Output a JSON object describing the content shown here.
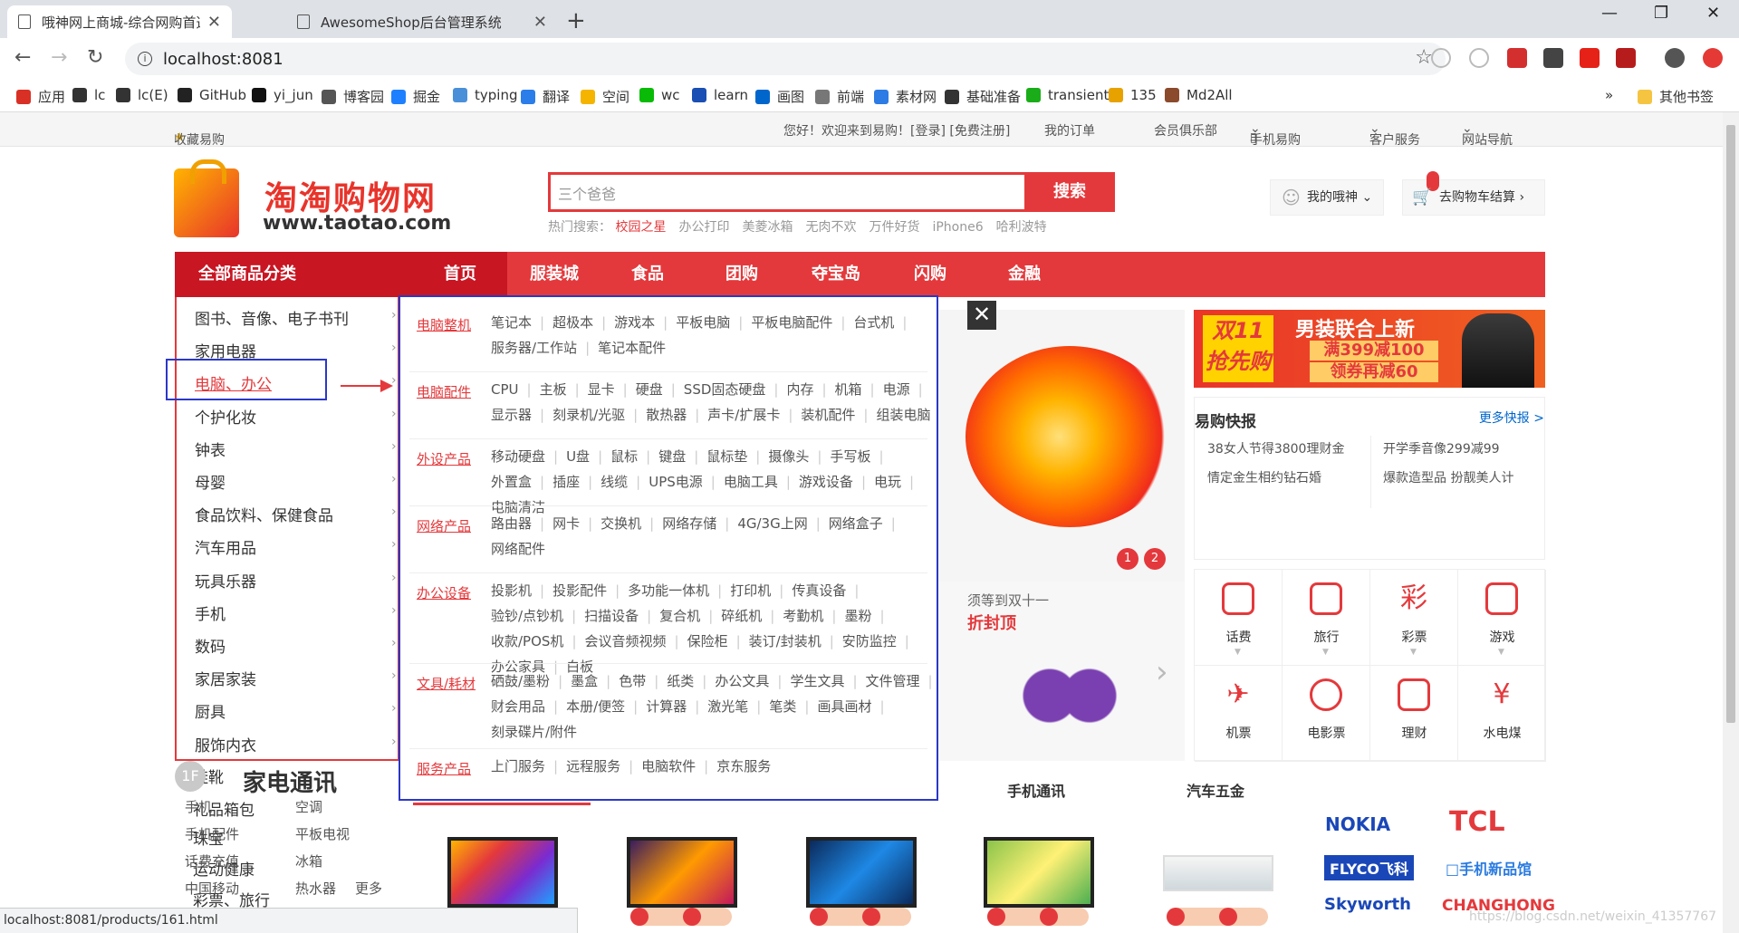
{
  "browser": {
    "tabs": [
      {
        "label": "哦神网上商城-综合网购首选（JD"
      },
      {
        "label": "AwesomeShop后台管理系统"
      }
    ],
    "new_tab": "+",
    "url": "localhost:8081",
    "window_controls": {
      "min": "—",
      "max": "❐",
      "close": "✕"
    }
  },
  "bookmarks": [
    {
      "label": "应用",
      "color": "#d93025"
    },
    {
      "label": "lc",
      "color": "#333333"
    },
    {
      "label": "lc(E)",
      "color": "#333333"
    },
    {
      "label": "GitHub",
      "color": "#222222"
    },
    {
      "label": "yi_jun",
      "color": "#111111"
    },
    {
      "label": "博客园",
      "color": "#555555"
    },
    {
      "label": "掘金",
      "color": "#1e80ff"
    },
    {
      "label": "typing",
      "color": "#4a90d9"
    },
    {
      "label": "翻译",
      "color": "#2b7de9"
    },
    {
      "label": "空间",
      "color": "#f5b400"
    },
    {
      "label": "wc",
      "color": "#09bb07"
    },
    {
      "label": "learn",
      "color": "#1a4fb3"
    },
    {
      "label": "画图",
      "color": "#0066cc"
    },
    {
      "label": "前端",
      "color": "#777777"
    },
    {
      "label": "素材网",
      "color": "#2d7be5"
    },
    {
      "label": "基础准备",
      "color": "#333333"
    },
    {
      "label": "transient",
      "color": "#1aad19"
    },
    {
      "label": "135",
      "color": "#e8a200"
    },
    {
      "label": "Md2All",
      "color": "#8b4a2b"
    }
  ],
  "bookmarks_more": "»",
  "bookmarks_other": "其他书签",
  "shortcut": {
    "fav": "收藏易购",
    "welcome": "您好！欢迎来到易购！[登录] [免费注册]",
    "orders": "我的订单",
    "club": "会员俱乐部",
    "mobile": "手机易购",
    "service": "客户服务",
    "sitenav": "网站导航"
  },
  "logo": {
    "cn": "淘淘购物网",
    "en": "www.taotao.com"
  },
  "search": {
    "placeholder": "三个爸爸",
    "button": "搜索",
    "hot_label": "热门搜索：",
    "hot": [
      "校园之星",
      "办公打印",
      "美菱冰箱",
      "无肉不欢",
      "万件好货",
      "iPhone6",
      "哈利波特"
    ]
  },
  "header": {
    "my": "我的哦神",
    "cart": "去购物车结算"
  },
  "nav": {
    "all": "全部商品分类",
    "items": [
      "首页",
      "服装城",
      "食品",
      "团购",
      "夺宝岛",
      "闪购",
      "金融"
    ]
  },
  "categories": [
    "图书、音像、电子书刊",
    "家用电器",
    "电脑、办公",
    "个护化妆",
    "钟表",
    "母婴",
    "食品饮料、保健食品",
    "汽车用品",
    "玩具乐器",
    "手机",
    "数码",
    "家居家装",
    "厨具",
    "服饰内衣"
  ],
  "categories_overflow": [
    "鞋靴",
    "礼品箱包",
    "珠宝",
    "运动健康",
    "彩票、旅行"
  ],
  "popup": {
    "close": "✕",
    "groups": [
      {
        "title": "电脑整机",
        "items": [
          "笔记本",
          "超极本",
          "游戏本",
          "平板电脑",
          "平板电脑配件",
          "台式机",
          "服务器/工作站",
          "笔记本配件"
        ]
      },
      {
        "title": "电脑配件",
        "items": [
          "CPU",
          "主板",
          "显卡",
          "硬盘",
          "SSD固态硬盘",
          "内存",
          "机箱",
          "电源",
          "显示器",
          "刻录机/光驱",
          "散热器",
          "声卡/扩展卡",
          "装机配件",
          "组装电脑"
        ]
      },
      {
        "title": "外设产品",
        "items": [
          "移动硬盘",
          "U盘",
          "鼠标",
          "键盘",
          "鼠标垫",
          "摄像头",
          "手写板",
          "外置盒",
          "插座",
          "线缆",
          "UPS电源",
          "电脑工具",
          "游戏设备",
          "电玩",
          "电脑清洁"
        ]
      },
      {
        "title": "网络产品",
        "items": [
          "路由器",
          "网卡",
          "交换机",
          "网络存储",
          "4G/3G上网",
          "网络盒子",
          "网络配件"
        ]
      },
      {
        "title": "办公设备",
        "items": [
          "投影机",
          "投影配件",
          "多功能一体机",
          "打印机",
          "传真设备",
          "验钞/点钞机",
          "扫描设备",
          "复合机",
          "碎纸机",
          "考勤机",
          "墨粉",
          "收款/POS机",
          "会议音频视频",
          "保险柜",
          "装订/封装机",
          "安防监控",
          "办公家具",
          "白板"
        ]
      },
      {
        "title": "文具/耗材",
        "items": [
          "硒鼓/墨粉",
          "墨盒",
          "色带",
          "纸类",
          "办公文具",
          "学生文具",
          "文件管理",
          "财会用品",
          "本册/便签",
          "计算器",
          "激光笔",
          "笔类",
          "画具画材",
          "刻录碟片/附件"
        ]
      },
      {
        "title": "服务产品",
        "items": [
          "上门服务",
          "远程服务",
          "电脑软件",
          "京东服务"
        ]
      }
    ]
  },
  "banner": {
    "dots": [
      "1",
      "2"
    ],
    "promo_line1": "须等到双十一",
    "promo_line2": "折封顶",
    "next": "›"
  },
  "ad": {
    "tag": "双11\n抢先购",
    "title": "男装联合上新",
    "line1": "满399减100",
    "line2": "领券再减60"
  },
  "news": {
    "title": "易购快报",
    "more": "更多快报 >",
    "items": [
      "38女人节得3800理财金",
      "开学季音像299减99",
      "情定金生相约钻石婚",
      "爆款造型品 扮靓美人计"
    ]
  },
  "services": [
    {
      "label": "话费",
      "icon": "phone-icon",
      "glyph": ""
    },
    {
      "label": "旅行",
      "icon": "suitcase-icon",
      "glyph": ""
    },
    {
      "label": "彩票",
      "icon": "lottery-icon",
      "glyph": "彩"
    },
    {
      "label": "游戏",
      "icon": "gamepad-icon",
      "glyph": ""
    },
    {
      "label": "机票",
      "icon": "plane-icon",
      "glyph": "✈"
    },
    {
      "label": "电影票",
      "icon": "film-icon",
      "glyph": ""
    },
    {
      "label": "理财",
      "icon": "piggy-icon",
      "glyph": ""
    },
    {
      "label": "水电煤",
      "icon": "yen-icon",
      "glyph": "¥"
    }
  ],
  "floor": {
    "num": "1F",
    "title": "家电通讯",
    "left_links": [
      "手机",
      "空调",
      "手机配件",
      "平板电视",
      "话费充值",
      "冰箱",
      "中国移动",
      "热水器",
      "更多"
    ],
    "tabs": [
      "手机通讯",
      "汽车五金"
    ]
  },
  "brands": [
    "NOKIA",
    "TCL",
    "FLYCO飞科",
    "□手机新品馆",
    "Skyworth",
    "CHANGHONG"
  ],
  "status_url": "localhost:8081/products/161.html",
  "watermark": "https://blog.csdn.net/weixin_41357767"
}
